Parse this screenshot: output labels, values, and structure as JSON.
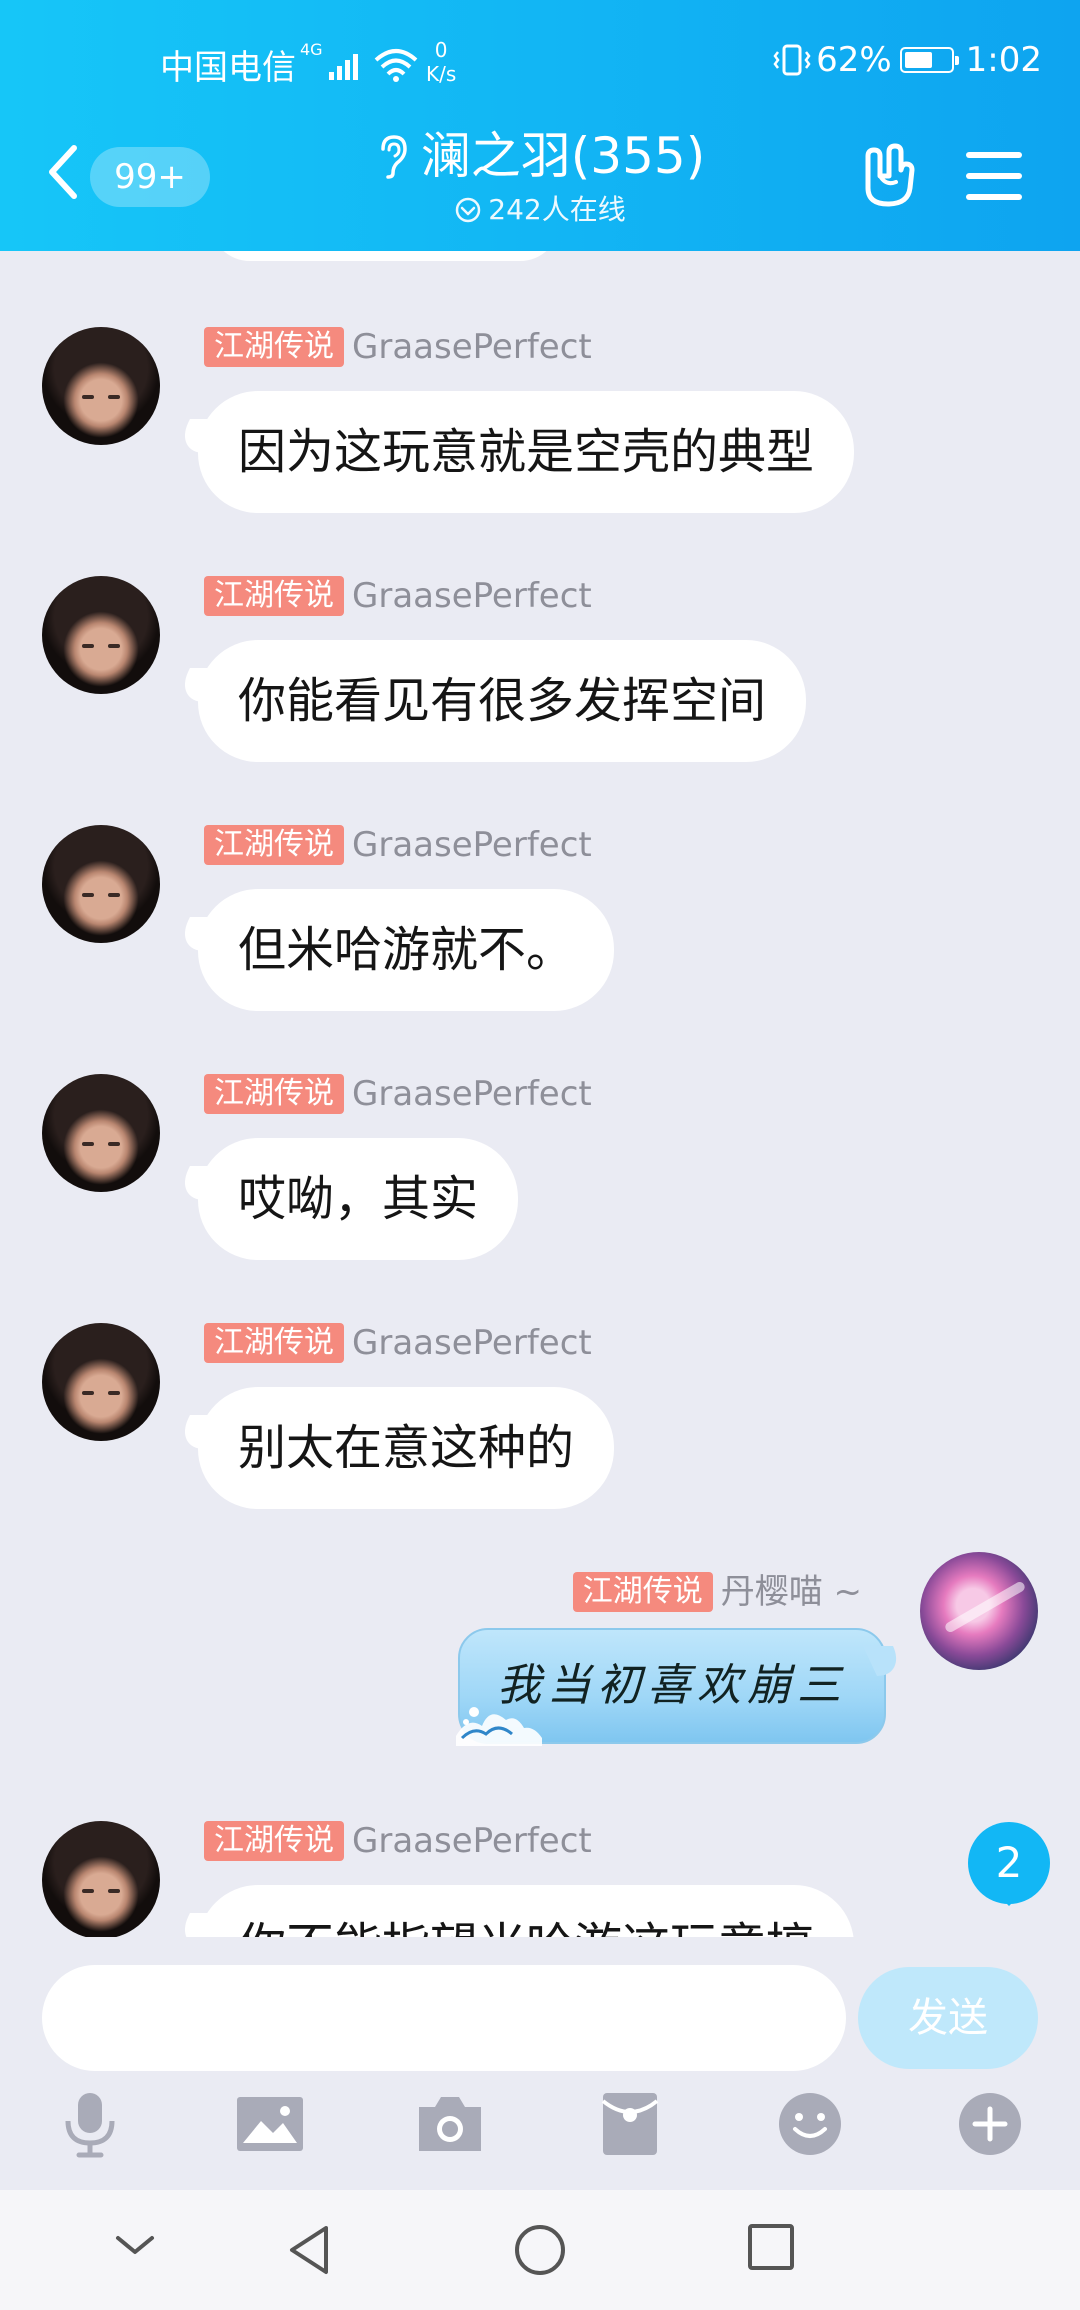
{
  "status_bar": {
    "carrier": "中国电信",
    "net_type": "4G",
    "net_speed_value": "0",
    "net_speed_unit": "K/s",
    "battery": "62%",
    "battery_level": 0.62,
    "time": "1:02"
  },
  "header": {
    "unread_count": "99+",
    "group_name": "澜之羽(355)",
    "online_text": "242人在线"
  },
  "messages": [
    {
      "rank": "江湖传说",
      "sender": "GraasePerfect",
      "text": "因为这玩意就是空壳的典型"
    },
    {
      "rank": "江湖传说",
      "sender": "GraasePerfect",
      "text": "你能看见有很多发挥空间"
    },
    {
      "rank": "江湖传说",
      "sender": "GraasePerfect",
      "text": "但米哈游就不。"
    },
    {
      "rank": "江湖传说",
      "sender": "GraasePerfect",
      "text": "哎呦，其实"
    },
    {
      "rank": "江湖传说",
      "sender": "GraasePerfect",
      "text": "别太在意这种的"
    }
  ],
  "self_message": {
    "rank": "江湖传说",
    "sender": "丹樱喵 ~",
    "text": "我当初喜欢崩三"
  },
  "last_message": {
    "rank": "江湖传说",
    "sender": "GraasePerfect",
    "text": "你不能指望米哈游这玩意搞"
  },
  "new_message_count": "2",
  "input": {
    "value": "",
    "placeholder": "",
    "send_label": "发送"
  },
  "toolbar": [
    "microphone-icon",
    "image-icon",
    "camera-icon",
    "red-packet-icon",
    "emoji-icon",
    "plus-icon"
  ],
  "colors": {
    "header": "#12b6f4",
    "rank_badge": "#f58a7e",
    "background": "#eaebf3",
    "send_button": "#bfe8fb"
  }
}
